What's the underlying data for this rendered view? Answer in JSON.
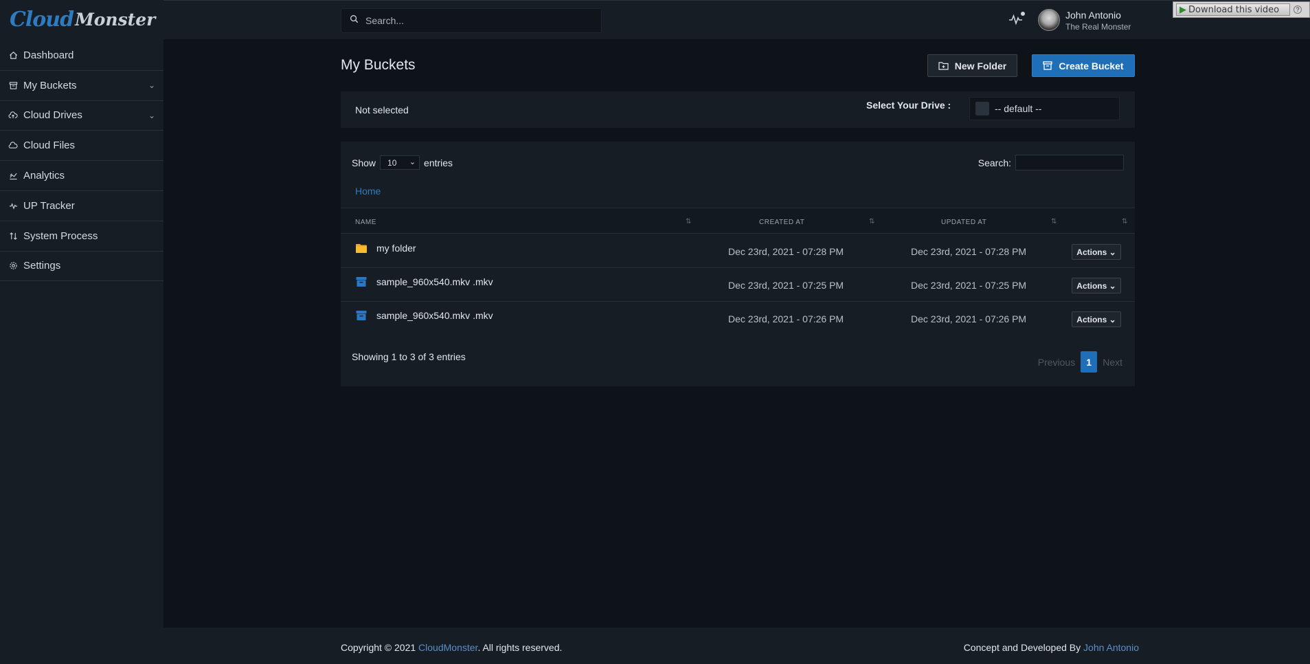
{
  "brand": {
    "part1": "Cloud",
    "part2": "Monster"
  },
  "sidebar": {
    "items": [
      {
        "label": "Dashboard",
        "icon": "home-icon"
      },
      {
        "label": "My Buckets",
        "icon": "bucket-icon"
      },
      {
        "label": "Cloud Drives",
        "icon": "cloud-upload-icon"
      },
      {
        "label": "Cloud Files",
        "icon": "cloud-icon"
      },
      {
        "label": "Analytics",
        "icon": "analytics-icon"
      },
      {
        "label": "UP Tracker",
        "icon": "pulse-icon"
      },
      {
        "label": "System Process",
        "icon": "sort-arrows-icon"
      },
      {
        "label": "Settings",
        "icon": "gear-icon"
      }
    ]
  },
  "topbar": {
    "search_placeholder": "Search...",
    "user_name": "John Antonio",
    "user_subtitle": "The Real Monster",
    "download_video": "Download this video",
    "help": "?"
  },
  "main": {
    "title": "My Buckets",
    "new_folder": "New Folder",
    "create_bucket": "Create Bucket",
    "not_selected": "Not selected",
    "drive_label": "Select Your Drive :",
    "drive_value": "-- default --"
  },
  "table": {
    "show_label": "Show",
    "entries_label": "entries",
    "page_size": "10",
    "search_label": "Search:",
    "breadcrumb": "Home",
    "headers": {
      "name": "NAME",
      "created": "CREATED AT",
      "updated": "UPDATED AT"
    },
    "sort_glyph": "⇅",
    "actions_label": "Actions ⌄",
    "rows": [
      {
        "name": "my folder",
        "type": "folder",
        "created": "Dec 23rd, 2021 - 07:28 PM",
        "updated": "Dec 23rd, 2021 - 07:28 PM"
      },
      {
        "name": "sample_960x540.mkv .mkv",
        "type": "file",
        "created": "Dec 23rd, 2021 - 07:25 PM",
        "updated": "Dec 23rd, 2021 - 07:25 PM"
      },
      {
        "name": "sample_960x540.mkv .mkv",
        "type": "file",
        "created": "Dec 23rd, 2021 - 07:26 PM",
        "updated": "Dec 23rd, 2021 - 07:26 PM"
      }
    ],
    "showing": "Showing 1 to 3 of 3 entries",
    "previous": "Previous",
    "page": "1",
    "next": "Next"
  },
  "footer": {
    "copyright_prefix": "Copyright © 2021 ",
    "brand_link": "CloudMonster",
    "copyright_suffix": ". All rights reserved.",
    "credit_prefix": "Concept and Developed By ",
    "author_link": "John Antonio"
  },
  "colors": {
    "accent": "#1f6fb8",
    "link": "#2e7bc0",
    "folder": "#f0a81c",
    "file": "#2a78c4"
  }
}
